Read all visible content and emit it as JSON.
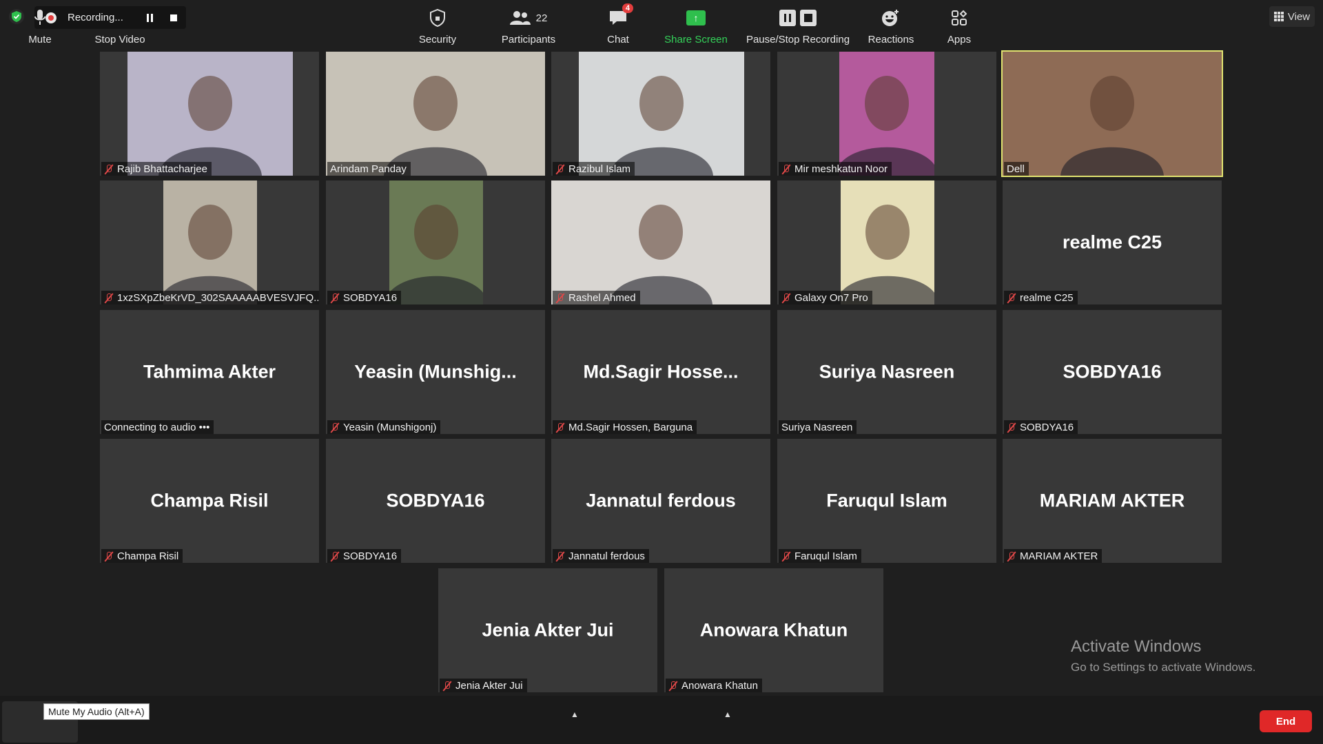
{
  "recording": {
    "label": "Recording..."
  },
  "view_button": {
    "label": "View"
  },
  "tiles": [
    {
      "name": "Rajib Bhattacharjee",
      "muted": true,
      "video": true,
      "bg": "#b9b4c8"
    },
    {
      "name": "Arindam Panday",
      "muted": false,
      "video": true,
      "bg": "#c7c2b7"
    },
    {
      "name": "Razibul Islam",
      "muted": true,
      "video": true,
      "bg": "#d5d7d8"
    },
    {
      "name": "Mir meshkatun Noor",
      "muted": true,
      "video": true,
      "bg": "#b45a9c"
    },
    {
      "name": "Dell",
      "muted": false,
      "video": true,
      "bg": "#8e6b55",
      "active": true
    },
    {
      "name": "1xzSXpZbeKrVD_302SAAAAABVESVJFQ...",
      "muted": true,
      "video": true,
      "bg": "#b9b2a4"
    },
    {
      "name": "SOBDYA16",
      "muted": true,
      "video": true,
      "bg": "#6a7a55"
    },
    {
      "name": "Rashel Ahmed",
      "muted": true,
      "video": true,
      "bg": "#d9d6d2"
    },
    {
      "name": "Galaxy On7 Pro",
      "muted": true,
      "video": true,
      "bg": "#e6dfb8"
    },
    {
      "name": "realme C25",
      "display": "realme C25",
      "muted": true,
      "video": false
    },
    {
      "name": "Tahmima Akter",
      "display": "Tahmima Akter",
      "muted": false,
      "video": false,
      "status": "Connecting to audio •••"
    },
    {
      "name": "Yeasin (Munshigonj)",
      "display": "Yeasin  (Munshig...",
      "muted": true,
      "video": false
    },
    {
      "name": "Md.Sagir Hossen, Barguna",
      "display": "Md.Sagir  Hosse...",
      "muted": true,
      "video": false
    },
    {
      "name": "Suriya Nasreen",
      "display": "Suriya Nasreen",
      "muted": false,
      "video": false
    },
    {
      "name": "SOBDYA16",
      "display": "SOBDYA16",
      "muted": true,
      "video": false
    },
    {
      "name": "Champa Risil",
      "display": "Champa Risil",
      "muted": true,
      "video": false
    },
    {
      "name": "SOBDYA16",
      "display": "SOBDYA16",
      "muted": true,
      "video": false
    },
    {
      "name": "Jannatul ferdous",
      "display": "Jannatul ferdous",
      "muted": true,
      "video": false
    },
    {
      "name": "Faruqul Islam",
      "display": "Faruqul Islam",
      "muted": true,
      "video": false
    },
    {
      "name": "MARIAM AKTER",
      "display": "MARIAM AKTER",
      "muted": true,
      "video": false
    },
    {
      "name": "Jenia Akter Jui",
      "display": "Jenia Akter Jui",
      "muted": true,
      "video": false
    },
    {
      "name": "Anowara Khatun",
      "display": "Anowara Khatun",
      "muted": true,
      "video": false
    }
  ],
  "watermark": {
    "line1": "Activate Windows",
    "line2": "Go to Settings to activate Windows."
  },
  "toolbar": {
    "mute": "Mute",
    "mute_tooltip": "Mute My Audio (Alt+A)",
    "stop_video": "Stop Video",
    "security": "Security",
    "participants": "Participants",
    "participants_count": "22",
    "chat": "Chat",
    "chat_badge": "4",
    "share_screen": "Share Screen",
    "pause_stop_recording": "Pause/Stop Recording",
    "reactions": "Reactions",
    "apps": "Apps",
    "end": "End"
  }
}
